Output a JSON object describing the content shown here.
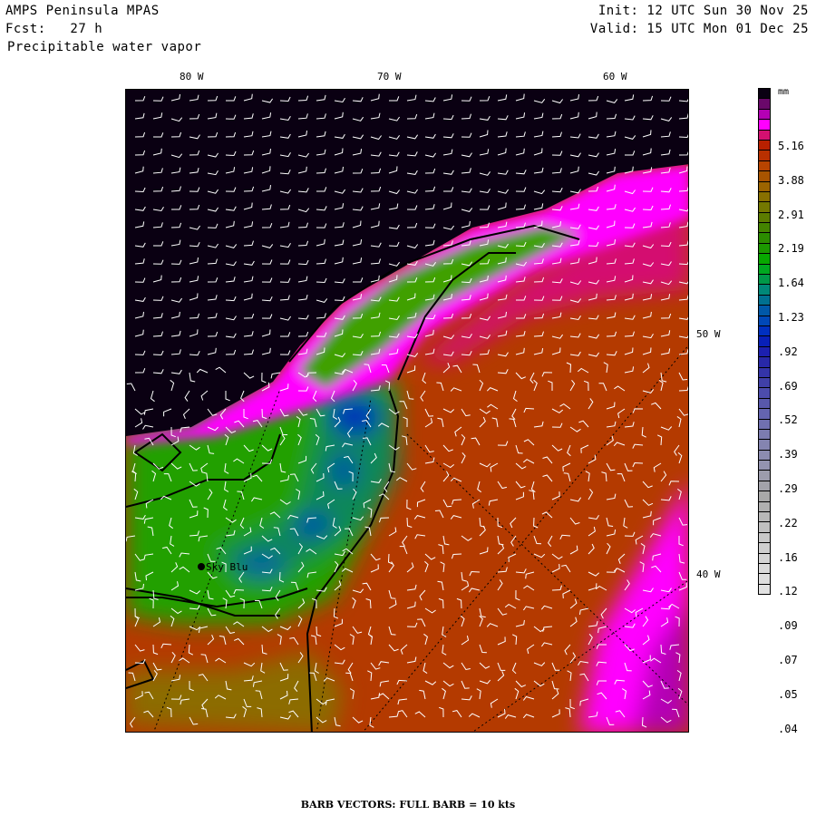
{
  "header": {
    "model": "AMPS Peninsula MPAS",
    "forecast": "Fcst:   27 h",
    "field": "Precipitable water vapor",
    "init": "Init: 12 UTC Sun 30 Nov 25",
    "valid": "Valid: 15 UTC Mon 01 Dec 25"
  },
  "map": {
    "lon_labels": [
      "80 W",
      "70 W",
      "60 W"
    ],
    "lat_labels": [
      "50 W",
      "40 W"
    ],
    "station": "Sky Blu"
  },
  "colorbar": {
    "units": "mm",
    "labels": [
      "5.16",
      "3.88",
      "2.91",
      "2.19",
      "1.64",
      "1.23",
      ".92",
      ".69",
      ".52",
      ".39",
      ".29",
      ".22",
      ".16",
      ".12",
      ".09",
      ".07",
      ".05",
      ".04"
    ],
    "colors": [
      "#0a0012",
      "#6a086a",
      "#b400b4",
      "#ff00ff",
      "#d41070",
      "#b82000",
      "#b83000",
      "#b84400",
      "#a85400",
      "#9c6400",
      "#887000",
      "#747800",
      "#5c7c00",
      "#448400",
      "#2c8c00",
      "#1c9800",
      "#08a800",
      "#00a820",
      "#009848",
      "#008878",
      "#007090",
      "#0058a8",
      "#0048b8",
      "#0030c0",
      "#0820b8",
      "#1c20b0",
      "#2828a8",
      "#3434a8",
      "#4040a8",
      "#4c4cac",
      "#5858ac",
      "#6464b0",
      "#7070b0",
      "#7c7cb0",
      "#8484b0",
      "#8c8cb0",
      "#9494b0",
      "#9c9cac",
      "#a2a2aa",
      "#a8a8a8",
      "#b0b0b0",
      "#b8b8b8",
      "#c0c0c0",
      "#c8c8c8",
      "#cecece",
      "#d4d4d4",
      "#dadada",
      "#dedede",
      "#e2e2e2"
    ],
    "land": "#000000"
  },
  "footer": "BARB VECTORS:  FULL BARB = 10 kts"
}
